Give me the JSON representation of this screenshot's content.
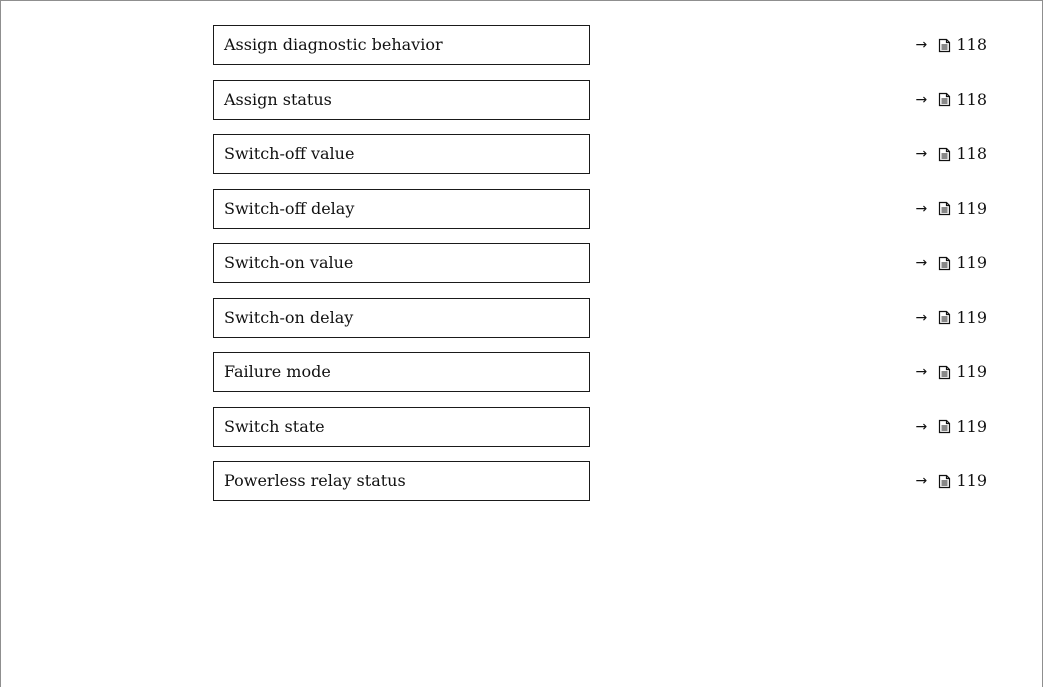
{
  "navigation_rows": [
    {
      "label": "Assign diagnostic behavior",
      "page": "118"
    },
    {
      "label": "Assign status",
      "page": "118"
    },
    {
      "label": "Switch-off value",
      "page": "118"
    },
    {
      "label": "Switch-off delay",
      "page": "119"
    },
    {
      "label": "Switch-on value",
      "page": "119"
    },
    {
      "label": "Switch-on delay",
      "page": "119"
    },
    {
      "label": "Failure mode",
      "page": "119"
    },
    {
      "label": "Switch state",
      "page": "119"
    },
    {
      "label": "Powerless relay status",
      "page": "119"
    }
  ],
  "reference": {
    "arrow": "→",
    "icon": "page-reference-icon"
  },
  "colors": {
    "border": "#1a1a1a",
    "text": "#111111",
    "frame": "#8f8f8f"
  }
}
